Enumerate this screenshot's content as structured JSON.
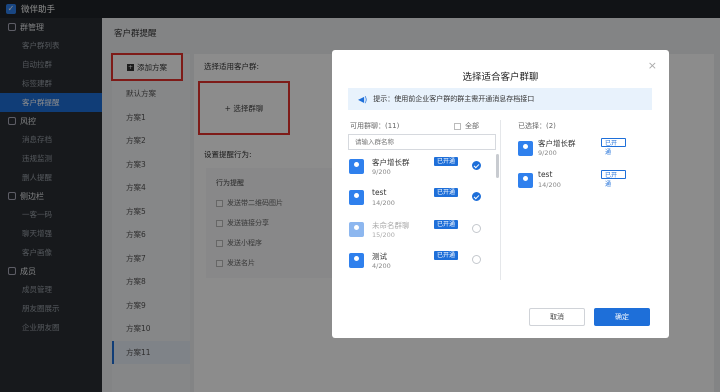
{
  "app": {
    "title": "微伴助手"
  },
  "sidebar": {
    "groups": [
      {
        "label": "群管理",
        "items": [
          "客户群列表",
          "自动拉群",
          "标签建群",
          "客户群提醒"
        ]
      },
      {
        "label": "风控",
        "items": [
          "消息存档",
          "违规监测",
          "删人提醒"
        ]
      },
      {
        "label": "侧边栏",
        "items": [
          "一客一码",
          "聊天增强",
          "客户画像"
        ]
      },
      {
        "label": "成员",
        "items": [
          "成员管理",
          "朋友圈展示",
          "企业朋友圈"
        ]
      }
    ],
    "active": "客户群提醒"
  },
  "page": {
    "breadcrumb": "客户群提醒",
    "add_plan": "添加方案",
    "plans": [
      "默认方案",
      "方案1",
      "方案2",
      "方案3",
      "方案4",
      "方案5",
      "方案6",
      "方案7",
      "方案8",
      "方案9",
      "方案10",
      "方案11"
    ],
    "active_plan": "方案11",
    "section_groups": "选择适用客户群:",
    "select_groups_btn": "+ 选择群聊",
    "section_behavior": "设置提醒行为:",
    "behavior_title": "行为提醒",
    "behaviors": [
      "发送带二维码图片",
      "发送链接分享",
      "发送小程序",
      "发送名片"
    ]
  },
  "modal": {
    "title": "选择适合客户群聊",
    "close": "×",
    "tip": "提示：使用前企业客户群的群主需开通消息存档接口",
    "available_label": "可用群聊：(11)",
    "select_all": "全部",
    "search_placeholder": "请输入群名称",
    "groups": [
      {
        "name": "客户增长群",
        "count": "9/200",
        "tag": "已开通",
        "selected": true
      },
      {
        "name": "test",
        "count": "14/200",
        "tag": "已开通",
        "selected": true
      },
      {
        "name": "未命名群聊",
        "count": "15/200",
        "tag": "已开通",
        "selected": false
      },
      {
        "name": "测试",
        "count": "4/200",
        "tag": "已开通",
        "selected": false
      }
    ],
    "selected_label": "已选择：(2)",
    "selected": [
      {
        "name": "客户增长群",
        "count": "9/200",
        "tag": "已开通"
      },
      {
        "name": "test",
        "count": "14/200",
        "tag": "已开通"
      }
    ],
    "cancel": "取消",
    "confirm": "确定"
  },
  "colors": {
    "accent": "#1e6fd9",
    "highlight_border": "#e5322d",
    "sidebar_bg": "#2b2f34"
  }
}
